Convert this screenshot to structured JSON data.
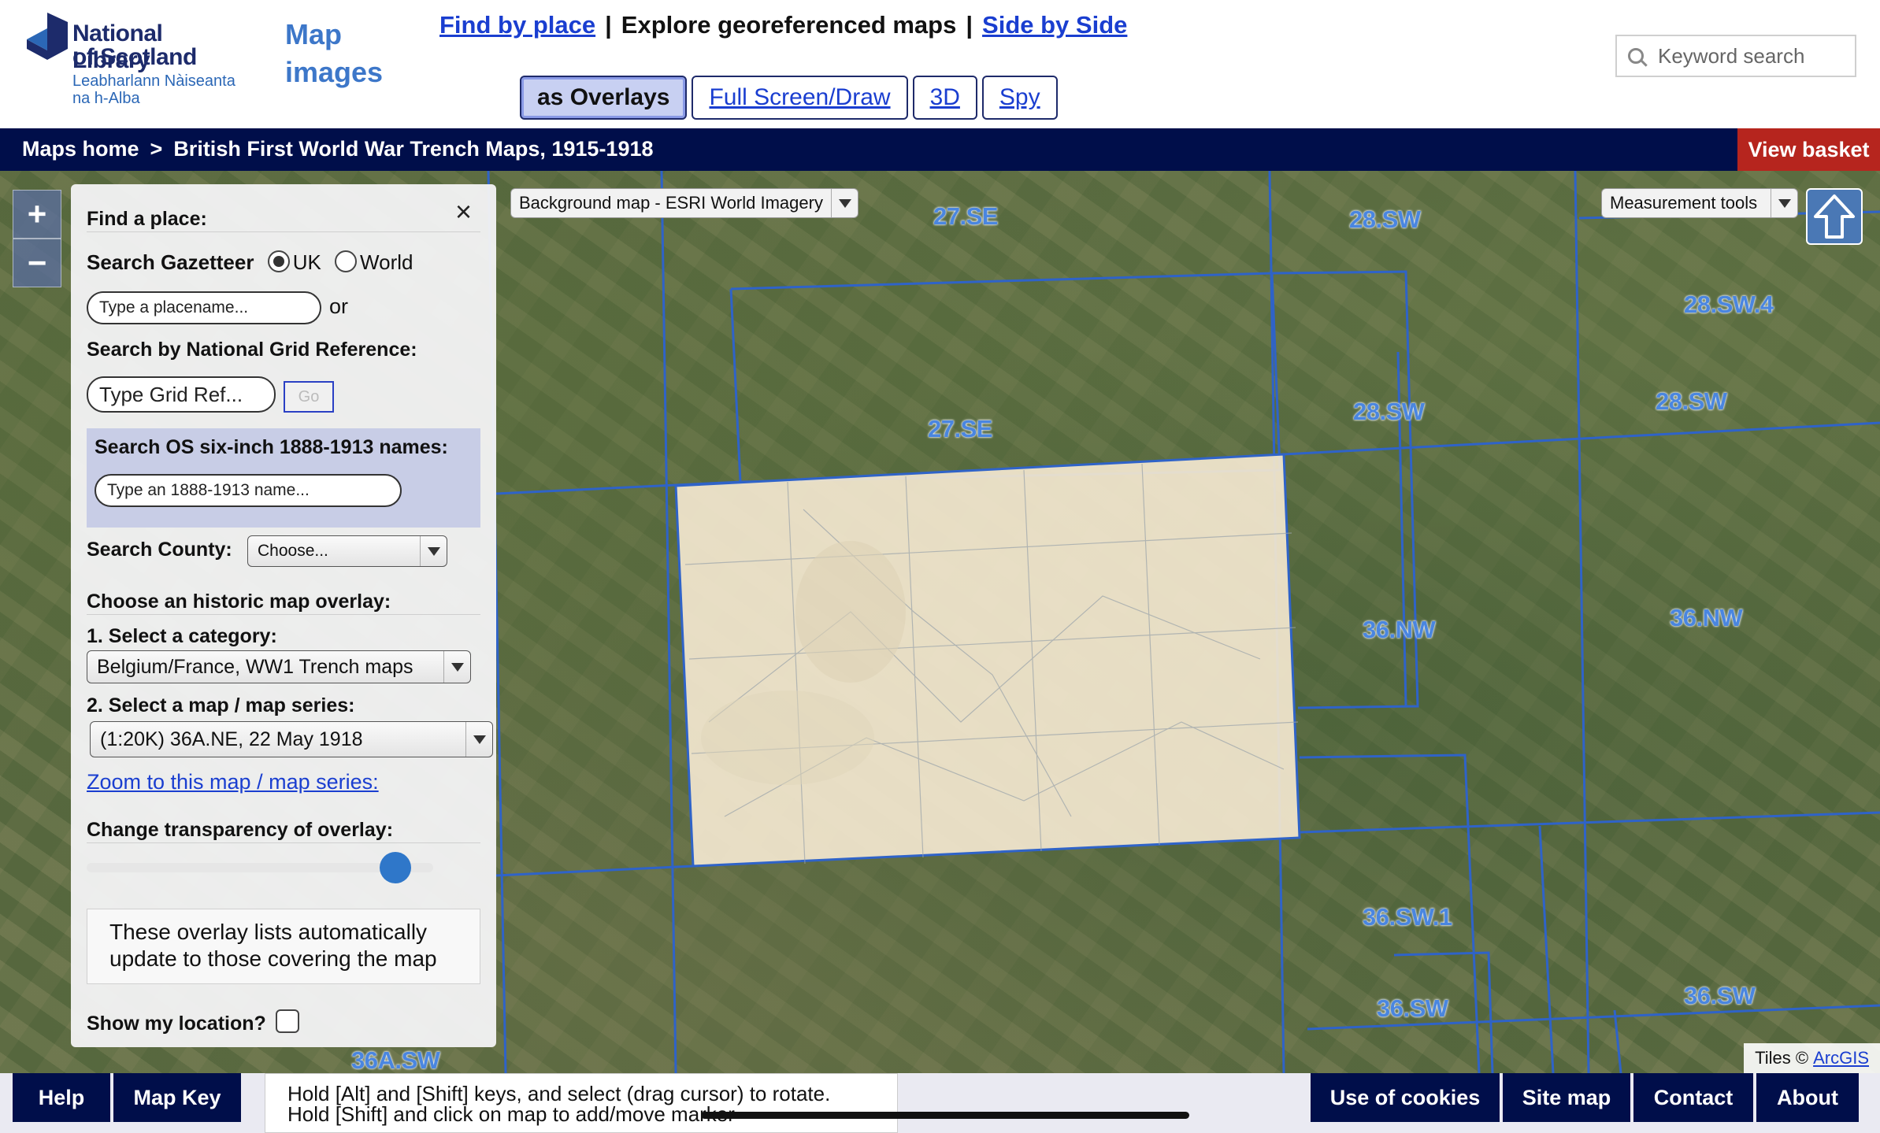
{
  "logo": {
    "line1": "National Library",
    "line2": "of Scotland",
    "line3": "Leabharlann Nàiseanta",
    "line4": "na h-Alba"
  },
  "site_title": "Map images",
  "topnav": {
    "find_by_place": "Find by place",
    "separator": "|",
    "explore": "Explore georeferenced maps",
    "side_by_side": "Side by Side"
  },
  "subnav": {
    "overlays": "as Overlays",
    "fullscreen": "Full Screen/Draw",
    "threed": "3D",
    "spy": "Spy"
  },
  "search": {
    "placeholder": "Keyword search"
  },
  "breadcrumb": {
    "home": "Maps home",
    "gt": ">",
    "current": "British First World War Trench Maps, 1915-1918"
  },
  "basket": "View basket",
  "map": {
    "background_select": "Background map - ESRI World Imagery",
    "measurement_select": "Measurement tools",
    "zoom_in": "+",
    "zoom_out": "−",
    "tiles_credit": "Tiles ©",
    "tiles_link": "ArcGIS",
    "grid_labels": [
      "27.SE",
      "28.SW",
      "28.SW.4",
      "27.SE",
      "28.SW",
      "28.SW",
      "36.NW",
      "36.NW",
      "36.SW.1",
      "36.SW",
      "36.SW",
      "36A.SW"
    ],
    "colors": {
      "grid": "#2f63c8",
      "overlay": "#f2e6cf"
    }
  },
  "panel": {
    "close": "×",
    "find_place": "Find a place:",
    "search_gazetteer": "Search Gazetteer",
    "radio_uk": "UK",
    "radio_world": "World",
    "placename_placeholder": "Type a placename...",
    "or": "or",
    "grid_ref_heading": "Search by National Grid Reference:",
    "grid_ref_placeholder": "Type Grid Ref...",
    "go": "Go",
    "os_heading": "Search OS six-inch 1888-1913 names:",
    "os_placeholder": "Type an 1888-1913 name...",
    "county_label": "Search County:",
    "county_value": "Choose...",
    "overlay_heading": "Choose an historic map overlay:",
    "category_label": "1. Select a category:",
    "category_value": "Belgium/France, WW1 Trench maps",
    "series_label": "2. Select a map / map series:",
    "series_value": "(1:20K) 36A.NE, 22 May 1918",
    "zoom_link": "Zoom to this map / map series:",
    "transparency_label": "Change transparency of overlay:",
    "transparency_level": 0.93,
    "note": "These overlay lists automatically update to those covering the map",
    "show_location": "Show my location?"
  },
  "footer": {
    "help": "Help",
    "map_key": "Map Key",
    "hint_line1": "Hold [Alt] and [Shift] keys, and select (drag cursor) to rotate.",
    "hint_line2": "Hold [Shift] and click on map to add/move marker",
    "cookies": "Use of cookies",
    "site_map": "Site map",
    "contact": "Contact",
    "about": "About"
  }
}
